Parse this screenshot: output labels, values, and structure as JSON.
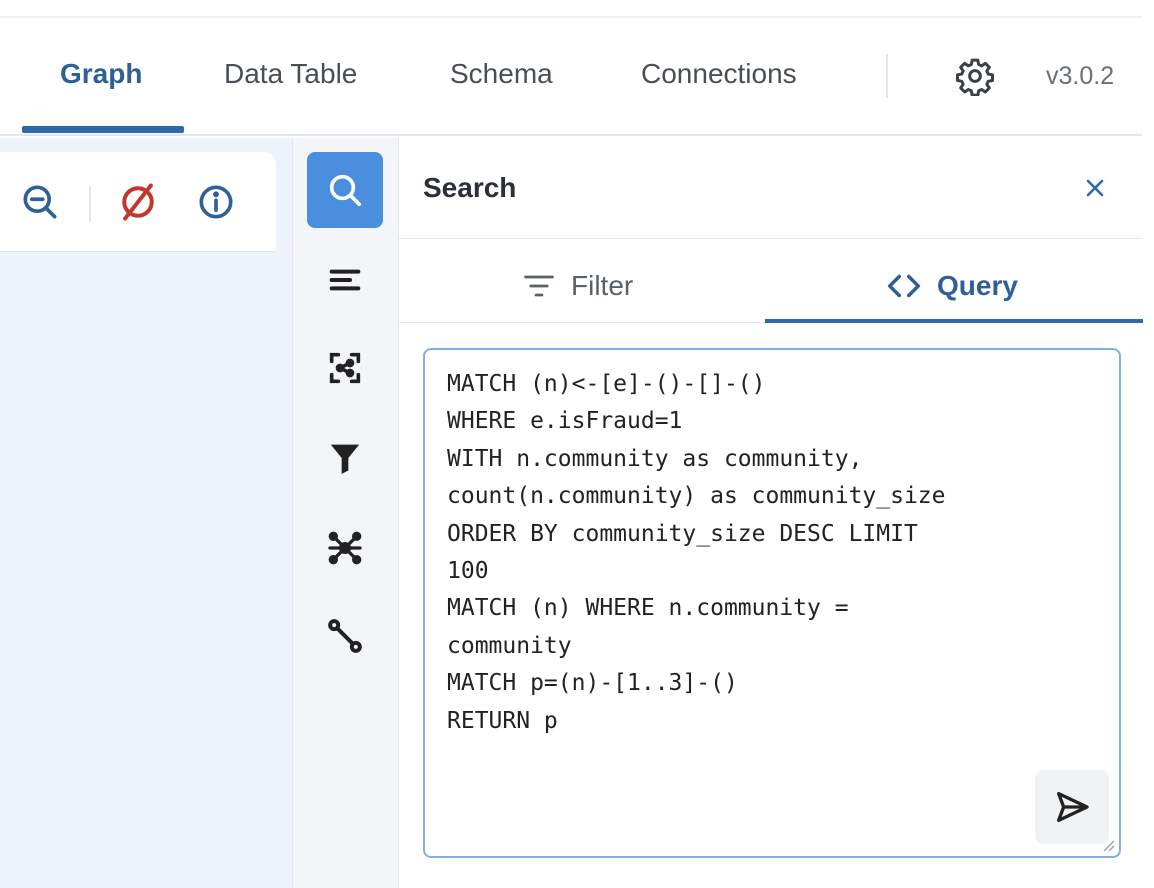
{
  "topnav": {
    "tabs": [
      {
        "label": "Graph",
        "active": true
      },
      {
        "label": "Data Table",
        "active": false
      },
      {
        "label": "Schema",
        "active": false
      },
      {
        "label": "Connections",
        "active": false
      }
    ],
    "settings_icon": "gear-icon",
    "version": "v3.0.2"
  },
  "toolbar": {
    "icons": [
      "zoom-out-icon",
      "clear-graph-icon",
      "info-icon"
    ]
  },
  "iconbar": {
    "items": [
      "search-icon",
      "list-icon",
      "layout-icon",
      "filter-icon",
      "network-icon",
      "path-icon"
    ],
    "active": "search-icon"
  },
  "panel": {
    "title": "Search",
    "subtabs": [
      {
        "label": "Filter",
        "active": false
      },
      {
        "label": "Query",
        "active": true
      }
    ],
    "query": "MATCH (n)<-[e]-()-[]-()\nWHERE e.isFraud=1\nWITH n.community as community,\ncount(n.community) as community_size\nORDER BY community_size DESC LIMIT\n100\nMATCH (n) WHERE n.community =\ncommunity\nMATCH p=(n)-[1..3]-()\nRETURN p"
  },
  "colors": {
    "accent": "#2e5f97",
    "active_icon_bg": "#4a8fdd",
    "danger": "#c0392b",
    "canvas_bg": "#eef3fb"
  }
}
